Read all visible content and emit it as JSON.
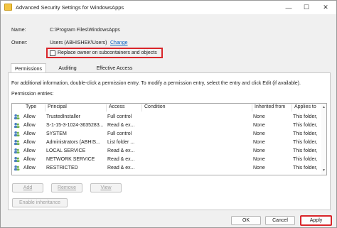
{
  "window": {
    "title": "Advanced Security Settings for WindowsApps"
  },
  "titlebar_buttons": {
    "minimize": "—",
    "maximize": "☐",
    "close": "✕"
  },
  "name": {
    "label": "Name:",
    "value": "C:\\Program Files\\WindowsApps"
  },
  "owner": {
    "label": "Owner:",
    "value": "Users (ABHISHEK\\Users)",
    "change_link": "Change"
  },
  "replace_owner": {
    "label": "Replace owner on subcontainers and objects",
    "checked": false
  },
  "tabs": [
    {
      "label": "Permissions",
      "active": true
    },
    {
      "label": "Auditing",
      "active": false
    },
    {
      "label": "Effective Access",
      "active": false
    }
  ],
  "permissions": {
    "info_text": "For additional information, double-click a permission entry. To modify a permission entry, select the entry and click Edit (if available).",
    "entries_label": "Permission entries:",
    "columns": [
      "Type",
      "Principal",
      "Access",
      "Condition",
      "Inherited from",
      "Applies to"
    ],
    "rows": [
      {
        "type": "Allow",
        "principal": "TrustedInstaller",
        "access": "Full control",
        "condition": "",
        "inherited": "None",
        "applies": "This folder,"
      },
      {
        "type": "Allow",
        "principal": "S-1-15-3-1024-3635283...",
        "access": "Read & ex...",
        "condition": "",
        "inherited": "None",
        "applies": "This folder,"
      },
      {
        "type": "Allow",
        "principal": "SYSTEM",
        "access": "Full control",
        "condition": "",
        "inherited": "None",
        "applies": "This folder,"
      },
      {
        "type": "Allow",
        "principal": "Administrators (ABHIS...",
        "access": "List folder ...",
        "condition": "",
        "inherited": "None",
        "applies": "This folder,"
      },
      {
        "type": "Allow",
        "principal": "LOCAL SERVICE",
        "access": "Read & ex...",
        "condition": "",
        "inherited": "None",
        "applies": "This folder,"
      },
      {
        "type": "Allow",
        "principal": "NETWORK SERVICE",
        "access": "Read & ex...",
        "condition": "",
        "inherited": "None",
        "applies": "This folder,"
      },
      {
        "type": "Allow",
        "principal": "RESTRICTED",
        "access": "Read & ex...",
        "condition": "",
        "inherited": "None",
        "applies": "This folder,"
      }
    ],
    "add_button": "Add",
    "remove_button": "Remove",
    "view_button": "View",
    "enable_inheritance_button": "Enable inheritance"
  },
  "footer": {
    "ok": "OK",
    "cancel": "Cancel",
    "apply": "Apply"
  },
  "colors": {
    "highlight": "#d9252a",
    "link": "#0b62c4"
  }
}
